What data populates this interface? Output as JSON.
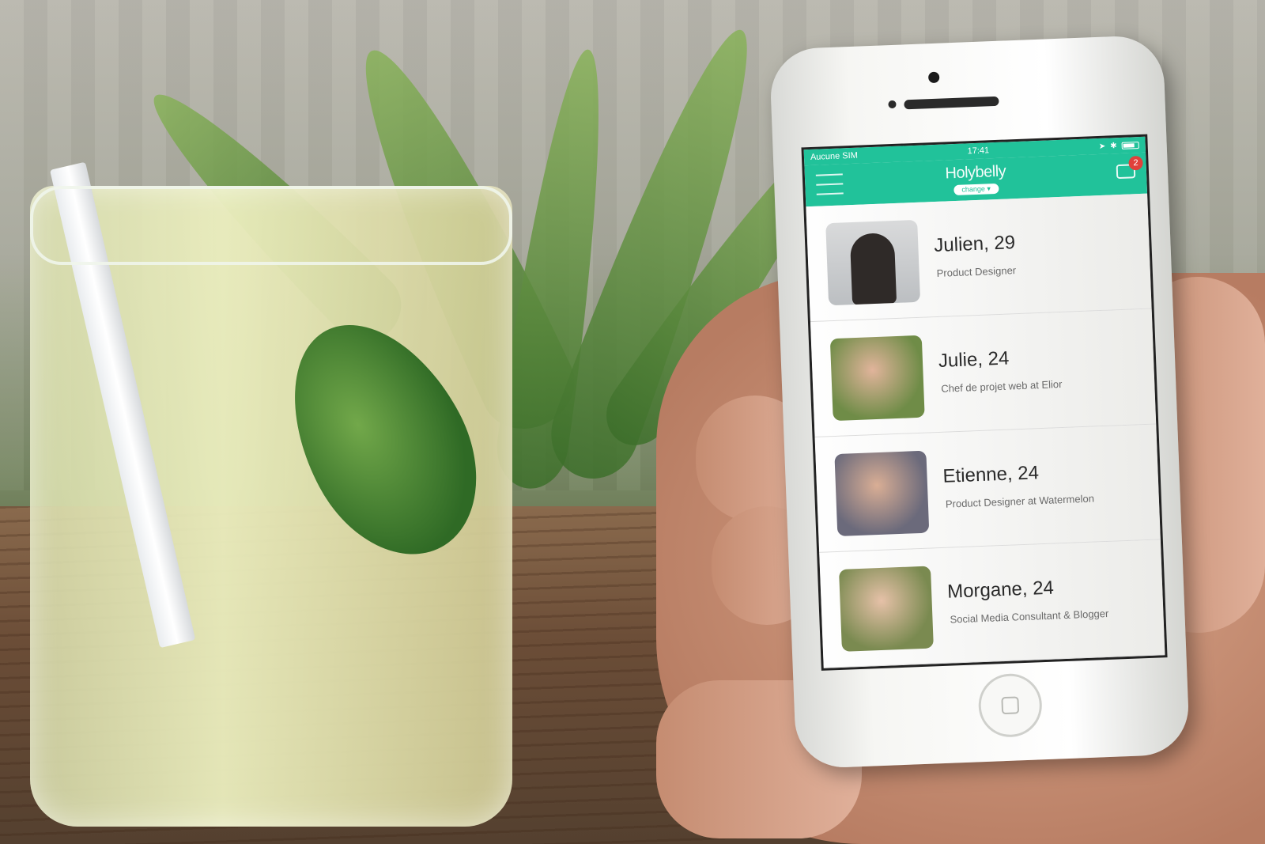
{
  "status_bar": {
    "carrier": "Aucune SIM",
    "time": "17:41"
  },
  "app": {
    "brand": "Holybelly",
    "change_label": "change ▾",
    "chat_badge_count": "2",
    "accent_color": "#21c29a"
  },
  "profiles": [
    {
      "name": "Julien, 29",
      "title": "Product Designer"
    },
    {
      "name": "Julie, 24",
      "title": "Chef de projet web at Elior"
    },
    {
      "name": "Etienne, 24",
      "title": "Product Designer at Watermelon"
    },
    {
      "name": "Morgane, 24",
      "title": "Social Media Consultant & Blogger"
    }
  ]
}
